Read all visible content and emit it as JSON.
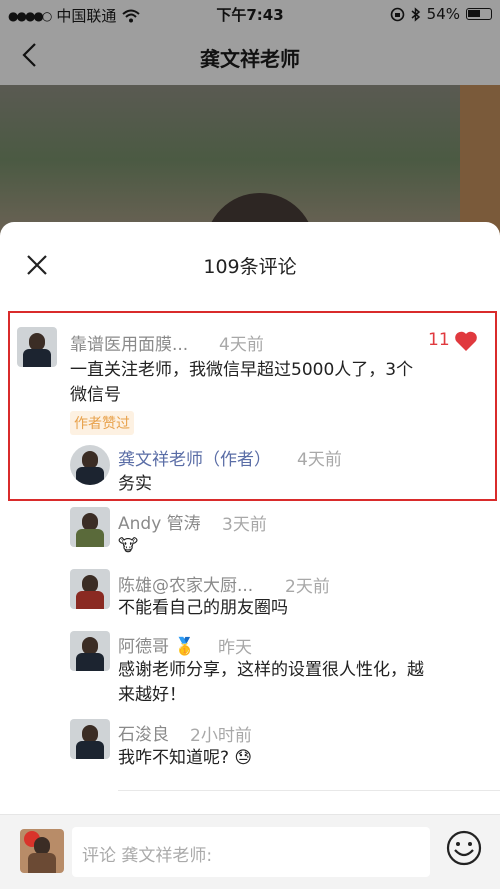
{
  "status_bar": {
    "carrier": "中国联通",
    "time": "下午7:43",
    "battery": "54%"
  },
  "nav": {
    "title": "龚文祥老师"
  },
  "sheet": {
    "comment_count": "109条评论"
  },
  "comments": [
    {
      "name": "靠谱医用面膜...",
      "time": "4天前",
      "text": "一直关注老师，我微信早超过5000人了，3个微信号",
      "badge": "作者赞过",
      "likes": "11",
      "reply": {
        "name": "龚文祥老师（作者）",
        "time": "4天前",
        "text": "务实"
      }
    },
    {
      "name": "Andy 管涛",
      "time": "3天前",
      "text": "🐮"
    },
    {
      "name": "陈雄@农家大厨...",
      "time": "2天前",
      "text": "不能看自己的朋友圈吗"
    },
    {
      "name": "阿德哥 🥇",
      "time": "昨天",
      "text": "感谢老师分享，这样的设置很人性化，越来越好！"
    },
    {
      "name": "石浚良",
      "time": "2小时前",
      "text": "我咋不知道呢? 😓"
    }
  ],
  "input": {
    "placeholder": "评论 龚文祥老师:"
  },
  "colors": {
    "highlight": "#d92b2b",
    "like": "#e0393e",
    "author_name": "#5a6da6"
  }
}
